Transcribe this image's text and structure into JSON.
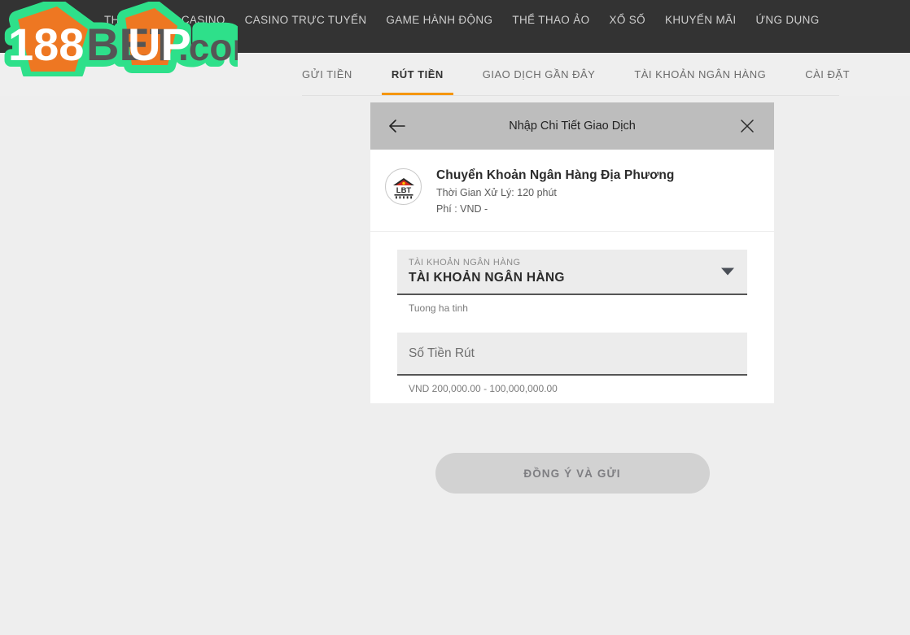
{
  "nav": {
    "items": [
      {
        "label": "THỂ THAO"
      },
      {
        "label": "CASINO"
      },
      {
        "label": "CASINO TRỰC TUYẾN"
      },
      {
        "label": "GAME HÀNH ĐỘNG"
      },
      {
        "label": "THỂ THAO ẢO"
      },
      {
        "label": "XỔ SỐ"
      },
      {
        "label": "KHUYẾN MÃI"
      },
      {
        "label": "ỨNG DỤNG"
      }
    ]
  },
  "logo": {
    "part1": "188",
    "part2": "BET",
    "part3": "UP",
    "part4": ".com",
    "orange": "#ee7722",
    "green": "#2ee08a",
    "gray": "#555555"
  },
  "tabs": [
    {
      "label": "GỬI TIỀN",
      "active": false
    },
    {
      "label": "RÚT TIỀN",
      "active": true
    },
    {
      "label": "GIAO DỊCH GẦN ĐÂY",
      "active": false
    },
    {
      "label": "TÀI KHOẢN NGÂN HÀNG",
      "active": false
    },
    {
      "label": "CÀI ĐẶT",
      "active": false
    }
  ],
  "modal": {
    "title": "Nhập Chi Tiết Giao Dịch",
    "back_icon": "arrow-left-icon",
    "close_icon": "close-icon",
    "header_color": "#bdbdbd"
  },
  "method": {
    "logo_text": "LBT",
    "logo_icon": "bank-building-icon",
    "title": "Chuyển Khoản Ngân Hàng Địa Phương",
    "processing_time": "Thời Gian Xử Lý: 120 phút",
    "fee": "Phí : VND -"
  },
  "bank_account_field": {
    "label": "TÀI KHOẢN NGÂN HÀNG",
    "value": "TÀI KHOẢN NGÂN HÀNG",
    "hint": "Tuong ha tinh",
    "caret_icon": "chevron-down-icon"
  },
  "amount_field": {
    "placeholder": "Số Tiền Rút",
    "value": "",
    "hint": "VND 200,000.00 - 100,000,000.00"
  },
  "submit": {
    "label": "ĐỒNG Ý VÀ GỬI",
    "disabled": true
  },
  "theme": {
    "nav_bg": "#333333",
    "page_bg": "#eeeeee",
    "accent": "#f5960a",
    "card_bg": "#ffffff",
    "field_bg": "#ececec"
  }
}
